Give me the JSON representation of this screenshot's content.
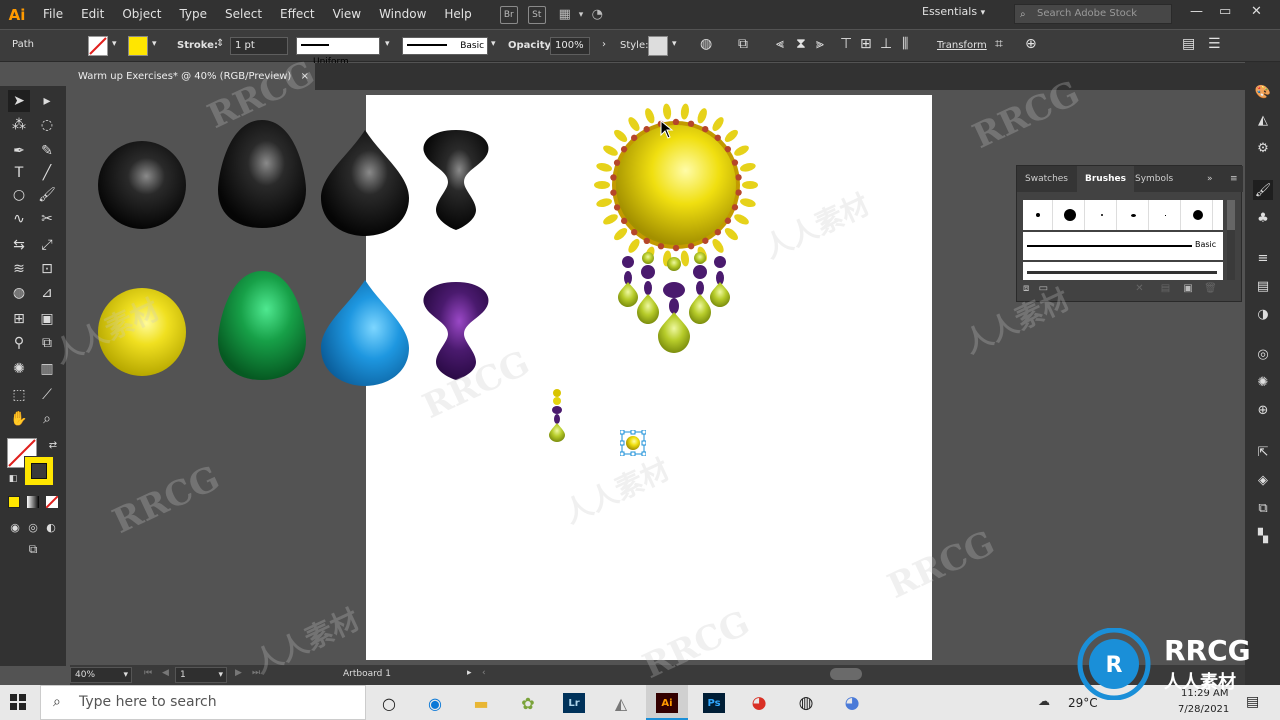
{
  "menubar": {
    "logo": "Ai",
    "items": [
      "File",
      "Edit",
      "Object",
      "Type",
      "Select",
      "Effect",
      "View",
      "Window",
      "Help"
    ],
    "br_label": "Br",
    "st_label": "St",
    "workspace": "Essentials",
    "search_placeholder": "Search Adobe Stock"
  },
  "controlbar": {
    "object_type": "Path",
    "stroke_label": "Stroke:",
    "stroke_value": "1 pt",
    "profile": "Uniform",
    "brush": "Basic",
    "opacity_label": "Opacity:",
    "opacity_value": "100%",
    "style_label": "Style:",
    "transform_label": "Transform"
  },
  "document_tab": {
    "title": "Warm up Exercises* @ 40% (RGB/Preview)",
    "close": "×"
  },
  "statusbar": {
    "zoom": "40%",
    "artboard_number": "1",
    "artboard_label": "Artboard 1"
  },
  "brushes_panel": {
    "tabs": [
      "Swatches",
      "Brushes",
      "Symbols"
    ],
    "active_tab": "Brushes",
    "basic_label": "Basic"
  },
  "taskbar": {
    "search_placeholder": "Type here to search",
    "temperature": "29°C",
    "time": "11:29 AM",
    "date": "7/28/2021",
    "apps": [
      {
        "name": "Lr",
        "color": "#00325a",
        "fg": "#add5ec"
      },
      {
        "name": "Ai",
        "color": "#330000",
        "fg": "#ff9a00"
      },
      {
        "name": "Ps",
        "color": "#001e36",
        "fg": "#31a8ff"
      }
    ]
  },
  "watermark": {
    "text": "RRCG",
    "subtext": "人人素材",
    "subtext2": "人人素材"
  },
  "colors": {
    "accent": "#1a8fd8",
    "fill_yellow": "#ffe600",
    "ui_dark": "#323232",
    "ui_mid": "#535353"
  }
}
